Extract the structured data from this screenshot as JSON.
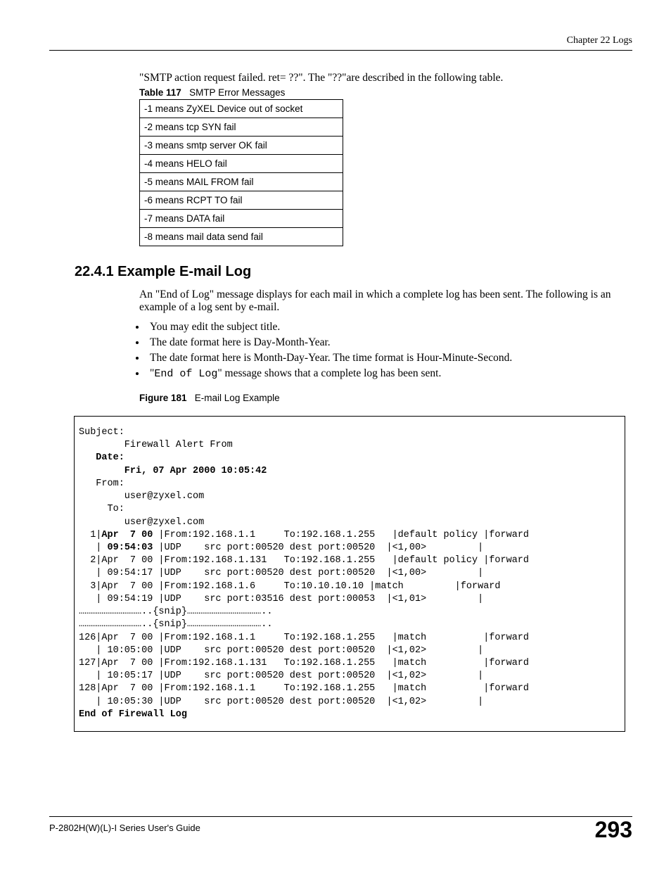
{
  "chapter_header": "Chapter 22 Logs",
  "intro": "\"SMTP action request failed. ret= ??\". The \"??\"are described in the following table.",
  "table_label_prefix": "Table 117",
  "table_label_text": "SMTP Error Messages",
  "table_rows": [
    "-1 means ZyXEL Device out of socket",
    "-2 means tcp SYN fail",
    "-3 means smtp server OK fail",
    "-4 means HELO fail",
    "-5 means MAIL FROM fail",
    "-6 means RCPT TO fail",
    "-7 means DATA fail",
    "-8 means mail data send fail"
  ],
  "section_heading": "22.4.1  Example E-mail Log",
  "para": "An \"End of Log\" message displays for each mail in which a complete log has been sent. The following is an example of a log sent by e-mail.",
  "bullets": {
    "b1": "You may edit the subject title.",
    "b2": "The date format here is Day-Month-Year.",
    "b3": "The date format here is Month-Day-Year. The time format is Hour-Minute-Second.",
    "b4_pre": "\"",
    "b4_code": "End of Log",
    "b4_post": "\" message shows that a complete log has been sent."
  },
  "figure_label_prefix": "Figure 181",
  "figure_label_text": "E-mail Log Example",
  "log": {
    "subject_label": "Subject:",
    "subject_value": "        Firewall Alert From ",
    "date_label": "   Date: ",
    "date_value": "        Fri, 07 Apr 2000 10:05:42",
    "from_label": "   From: ",
    "from_value": "        user@zyxel.com",
    "to_label": "     To: ",
    "to_value": "        user@zyxel.com",
    "r1a_pre": "  1|",
    "r1a_bold": "Apr  7 00",
    "r1a_post": " |From:192.168.1.1     To:192.168.1.255   |default policy |forward",
    "r1b_pre": "   | ",
    "r1b_bold": "09:54:03",
    "r1b_post": " |UDP    src port:00520 dest port:00520  |<1,00>         |         ",
    "r2a": "  2|Apr  7 00 |From:192.168.1.131   To:192.168.1.255   |default policy |forward",
    "r2b": "   | 09:54:17 |UDP    src port:00520 dest port:00520  |<1,00>         |         ",
    "r3a": "  3|Apr  7 00 |From:192.168.1.6     To:10.10.10.10 |match         |forward",
    "r3b": "   | 09:54:19 |UDP    src port:03516 dest port:00053  |<1,01>         |         ",
    "snip1": "……………………………..{snip}…………………………………..",
    "snip2": "……………………………..{snip}…………………………………..",
    "r126a": "126|Apr  7 00 |From:192.168.1.1     To:192.168.1.255   |match          |forward",
    "r126b": "   | 10:05:00 |UDP    src port:00520 dest port:00520  |<1,02>         |         ",
    "r127a": "127|Apr  7 00 |From:192.168.1.131   To:192.168.1.255   |match          |forward",
    "r127b": "   | 10:05:17 |UDP    src port:00520 dest port:00520  |<1,02>         |         ",
    "r128a": "128|Apr  7 00 |From:192.168.1.1     To:192.168.1.255   |match          |forward",
    "r128b": "   | 10:05:30 |UDP    src port:00520 dest port:00520  |<1,02>         |         ",
    "end": "End of Firewall Log"
  },
  "footer_left": "P-2802H(W)(L)-I Series User's Guide",
  "footer_right": "293"
}
